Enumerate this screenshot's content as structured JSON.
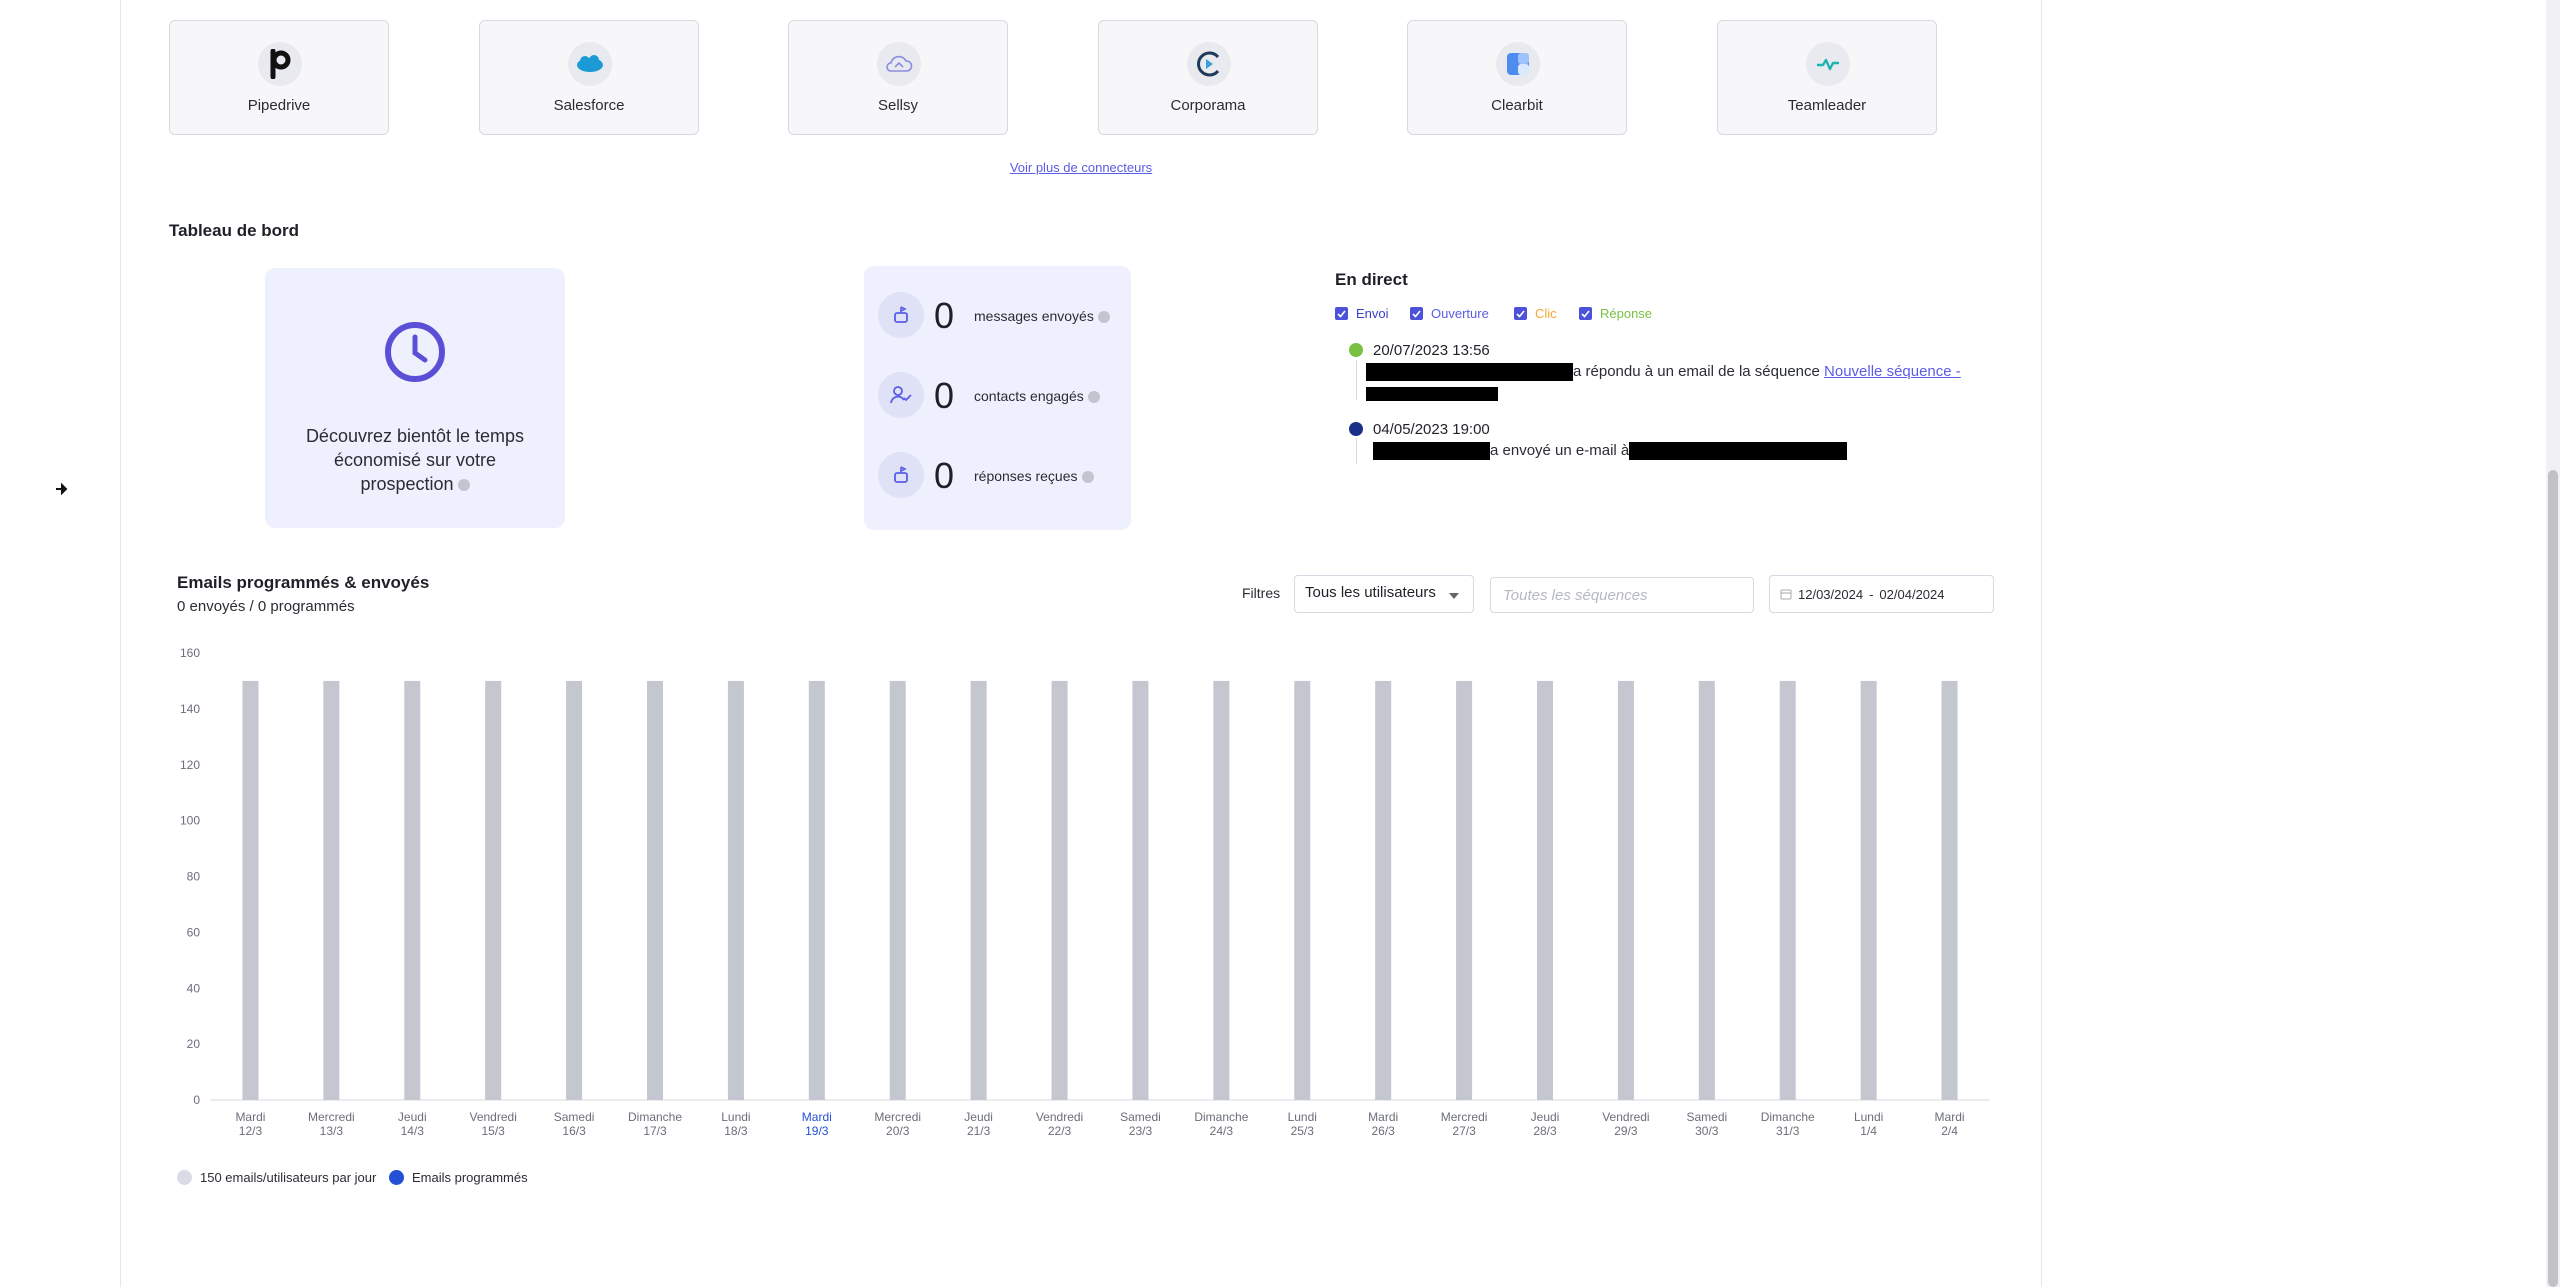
{
  "connectors": [
    {
      "name": "Pipedrive",
      "icon": "pipedrive-logo-icon"
    },
    {
      "name": "Salesforce",
      "icon": "salesforce-logo-icon"
    },
    {
      "name": "Sellsy",
      "icon": "sellsy-logo-icon"
    },
    {
      "name": "Corporama",
      "icon": "corporama-logo-icon"
    },
    {
      "name": "Clearbit",
      "icon": "clearbit-logo-icon"
    },
    {
      "name": "Teamleader",
      "icon": "teamleader-logo-icon"
    }
  ],
  "more_connectors_link": "Voir plus de connecteurs",
  "dashboard": {
    "title": "Tableau de bord",
    "time_saved_text": "Découvrez bientôt le temps économisé sur votre prospection",
    "stats": [
      {
        "value": "0",
        "label": "messages envoyés",
        "icon": "mailbox-icon"
      },
      {
        "value": "0",
        "label": "contacts engagés",
        "icon": "user-check-icon"
      },
      {
        "value": "0",
        "label": "réponses reçues",
        "icon": "mailbox-icon"
      }
    ]
  },
  "live": {
    "title": "En direct",
    "filters": [
      {
        "label": "Envoi",
        "color": "#3b3fc7",
        "checked": true
      },
      {
        "label": "Ouverture",
        "color": "#5a5de6",
        "checked": true
      },
      {
        "label": "Clic",
        "color": "#f0a92e",
        "checked": true
      },
      {
        "label": "Réponse",
        "color": "#7ac143",
        "checked": true
      }
    ],
    "events": [
      {
        "date": "20/07/2023 13:56",
        "dot_color": "#7ac143",
        "text": "a répondu à un email de la séquence",
        "link": "Nouvelle séquence -"
      },
      {
        "date": "04/05/2023 19:00",
        "dot_color": "#1a2e8a",
        "text": "a envoyé un e-mail à"
      }
    ]
  },
  "emails": {
    "title": "Emails programmés & envoyés",
    "subtitle": "0 envoyés / 0 programmés",
    "filters_label": "Filtres",
    "user_select": "Tous les utilisateurs",
    "sequence_placeholder": "Toutes les séquences",
    "date_start": "12/03/2024",
    "date_sep": "-",
    "date_end": "02/04/2024",
    "legend": [
      {
        "label": "150 emails/utilisateurs par jour",
        "color": "#d9dbe5"
      },
      {
        "label": "Emails programmés",
        "color": "#2450d6"
      }
    ]
  },
  "chart_data": {
    "type": "bar",
    "ylim": [
      0,
      160
    ],
    "yticks": [
      0,
      20,
      40,
      60,
      80,
      100,
      120,
      140,
      160
    ],
    "highlight_category": "Mardi 19/3",
    "categories": [
      [
        "Mardi",
        "12/3"
      ],
      [
        "Mercredi",
        "13/3"
      ],
      [
        "Jeudi",
        "14/3"
      ],
      [
        "Vendredi",
        "15/3"
      ],
      [
        "Samedi",
        "16/3"
      ],
      [
        "Dimanche",
        "17/3"
      ],
      [
        "Lundi",
        "18/3"
      ],
      [
        "Mardi",
        "19/3"
      ],
      [
        "Mercredi",
        "20/3"
      ],
      [
        "Jeudi",
        "21/3"
      ],
      [
        "Vendredi",
        "22/3"
      ],
      [
        "Samedi",
        "23/3"
      ],
      [
        "Dimanche",
        "24/3"
      ],
      [
        "Lundi",
        "25/3"
      ],
      [
        "Mardi",
        "26/3"
      ],
      [
        "Mercredi",
        "27/3"
      ],
      [
        "Jeudi",
        "28/3"
      ],
      [
        "Vendredi",
        "29/3"
      ],
      [
        "Samedi",
        "30/3"
      ],
      [
        "Dimanche",
        "31/3"
      ],
      [
        "Lundi",
        "1/4"
      ],
      [
        "Mardi",
        "2/4"
      ]
    ],
    "series": [
      {
        "name": "150 emails/utilisateurs par jour",
        "color": "#c4c6d0",
        "values": [
          150,
          150,
          150,
          150,
          150,
          150,
          150,
          150,
          150,
          150,
          150,
          150,
          150,
          150,
          150,
          150,
          150,
          150,
          150,
          150,
          150,
          150
        ]
      },
      {
        "name": "Emails programmés",
        "color": "#2450d6",
        "values": [
          0,
          0,
          0,
          0,
          0,
          0,
          0,
          0,
          0,
          0,
          0,
          0,
          0,
          0,
          0,
          0,
          0,
          0,
          0,
          0,
          0,
          0
        ]
      }
    ]
  }
}
